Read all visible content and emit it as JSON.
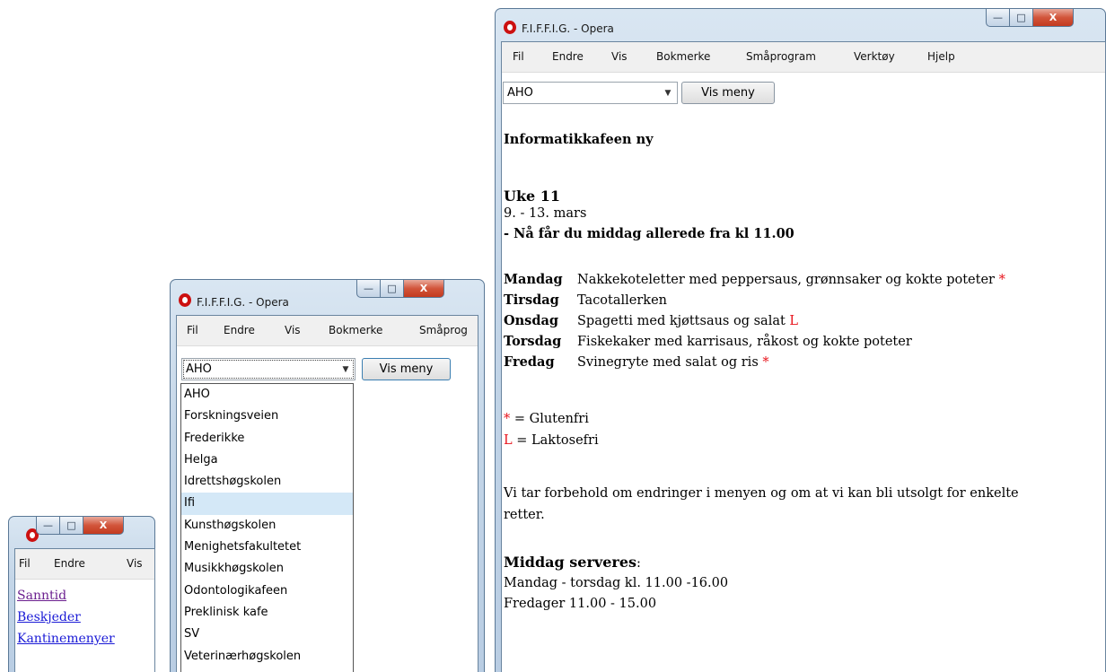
{
  "windows": {
    "small": {
      "menu": [
        "Fil",
        "Endre",
        "Vis"
      ],
      "links": [
        "Sanntid",
        "Beskjeder",
        "Kantinemenyer"
      ]
    },
    "middle": {
      "title": "F.I.F.F.I.G. - Opera",
      "menu": [
        "Fil",
        "Endre",
        "Vis",
        "Bokmerke",
        "Småprog"
      ],
      "select_value": "AHO",
      "button_label": "Vis meny",
      "options": [
        "AHO",
        "Forskningsveien",
        "Frederikke",
        "Helga",
        "Idrettshøgskolen",
        "Ifi",
        "Kunsthøgskolen",
        "Menighetsfakultetet",
        "Musikkhøgskolen",
        "Odontologikafeen",
        "Preklinisk kafe",
        "SV",
        "Veterinærhøgskolen"
      ],
      "highlighted_option": "Ifi"
    },
    "large": {
      "title": "F.I.F.F.I.G. - Opera",
      "menu": [
        "Fil",
        "Endre",
        "Vis",
        "Bokmerke",
        "Småprogram",
        "Verktøy",
        "Hjelp"
      ],
      "select_value": "AHO",
      "button_label": "Vis meny",
      "cafe_name": "Informatikkafeen ny",
      "week": "Uke 11",
      "dates": "9. - 13. mars",
      "notice": "- Nå får du middag allerede fra kl 11.00",
      "days": [
        {
          "day": "Mandag",
          "dish": "Nakkekoteletter med peppersaus, grønnsaker og kokte poteter",
          "mark": "*"
        },
        {
          "day": "Tirsdag",
          "dish": "Tacotallerken",
          "mark": ""
        },
        {
          "day": "Onsdag",
          "dish": "Spagetti med kjøttsaus og salat",
          "mark": "L"
        },
        {
          "day": "Torsdag",
          "dish": "Fiskekaker med karrisaus, råkost og kokte poteter",
          "mark": ""
        },
        {
          "day": "Fredag",
          "dish": "Svinegryte med salat og ris",
          "mark": "*"
        }
      ],
      "legend": [
        {
          "symbol": "*",
          "text": "= Glutenfri"
        },
        {
          "symbol": "L",
          "text": "= Laktosefri"
        }
      ],
      "disclaimer_1": "Vi tar forbehold om endringer i menyen og om at vi kan bli utsolgt for enkelte",
      "disclaimer_2": "retter.",
      "served_heading": "Middag serveres",
      "served_colon": ":",
      "served_lines": [
        "Mandag - torsdag kl. 11.00 -16.00",
        "Fredager 11.00 - 15.00"
      ]
    }
  },
  "colors": {
    "accent_red": "#e8141c",
    "link_blue": "#1a1ad6",
    "link_visited": "#6b1f8f",
    "highlight": "#d4e8f7"
  }
}
